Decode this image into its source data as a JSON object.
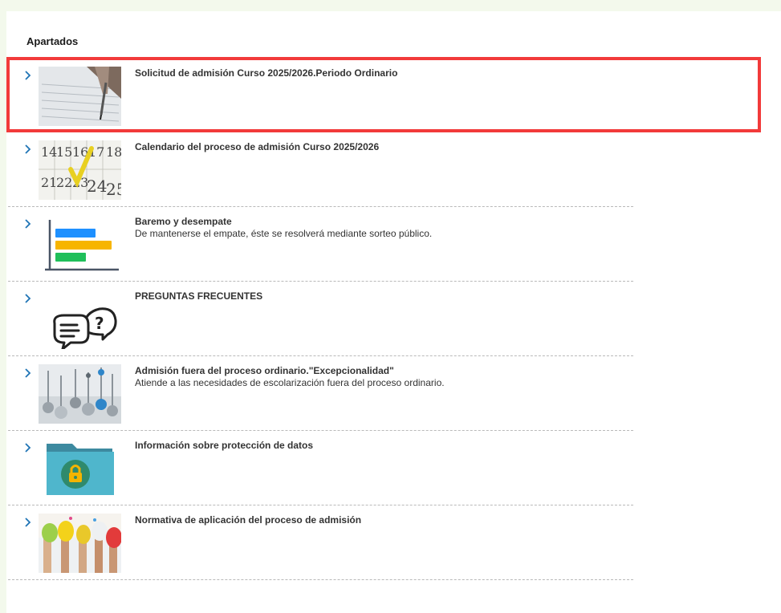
{
  "section": {
    "title": "Apartados"
  },
  "colors": {
    "highlight": "#f23a3a",
    "chevron": "#1f74b5",
    "background": "#f3f9ec"
  },
  "items": [
    {
      "title": "Solicitud de admisión Curso 2025/2026.Periodo Ordinario",
      "description": "",
      "icon": "form-writing-photo"
    },
    {
      "title": "Calendario del proceso de admisión Curso 2025/2026",
      "description": "",
      "icon": "calendar-photo"
    },
    {
      "title": "Baremo y desempate",
      "description": "De mantenerse el empate, éste se resolverá mediante sorteo público.",
      "icon": "bar-chart-icon"
    },
    {
      "title": "PREGUNTAS FRECUENTES",
      "description": "",
      "icon": "question-chat-icon"
    },
    {
      "title": "Admisión fuera del proceso ordinario.\"Excepcionalidad\"",
      "description": "Atiende a las necesidades de escolarización fuera del proceso ordinario.",
      "icon": "pins-photo"
    },
    {
      "title": "Información sobre protección de datos",
      "description": "",
      "icon": "locked-folder-icon"
    },
    {
      "title": "Normativa de aplicación del proceso de admisión",
      "description": "",
      "icon": "painted-hands-photo"
    }
  ]
}
